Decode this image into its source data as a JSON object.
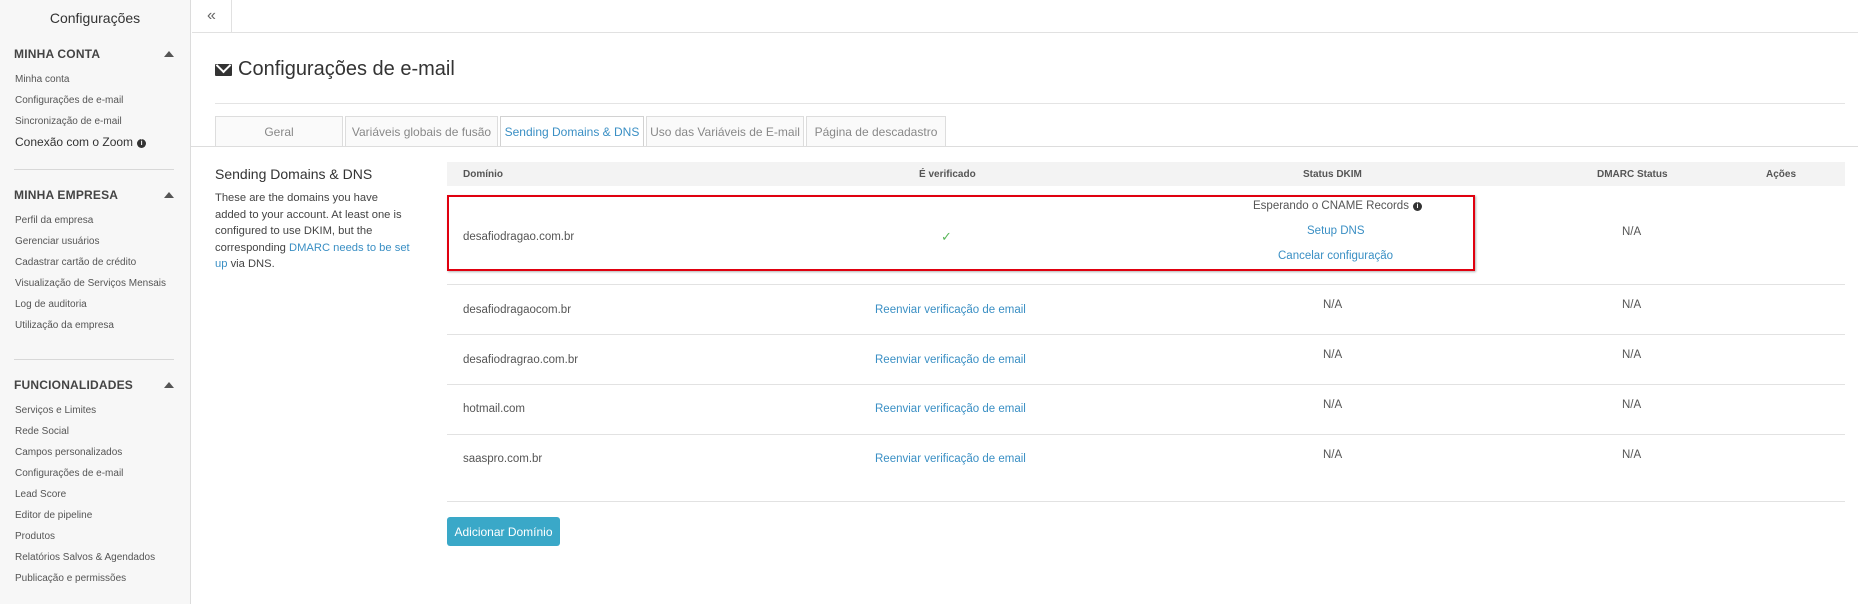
{
  "sidebar": {
    "title": "Configurações",
    "sections": [
      {
        "heading": "MINHA CONTA",
        "items": [
          "Minha conta",
          "Configurações de e-mail",
          "Sincronização de e-mail",
          "Conexão com o Zoom"
        ]
      },
      {
        "heading": "MINHA EMPRESA",
        "items": [
          "Perfil da empresa",
          "Gerenciar usuários",
          "Cadastrar cartão de crédito",
          "Visualização de Serviços Mensais",
          "Log de auditoria",
          "Utilização da empresa"
        ]
      },
      {
        "heading": "FUNCIONALIDADES",
        "items": [
          "Serviços e Limites",
          "Rede Social",
          "Campos personalizados",
          "Configurações de e-mail",
          "Lead Score",
          "Editor de pipeline",
          "Produtos",
          "Relatórios Salvos & Agendados",
          "Publicação e permissões"
        ]
      }
    ]
  },
  "topbar": {
    "collapse_glyph": "«"
  },
  "page": {
    "title": "Configurações de e-mail"
  },
  "tabs": [
    "Geral",
    "Variáveis globais de fusão",
    "Sending Domains & DNS",
    "Uso das Variáveis de E-mail",
    "Página de descadastro"
  ],
  "description": {
    "heading": "Sending Domains & DNS",
    "text_before": "These are the domains you have added to your account. At least one is configured to use DKIM, but the corresponding",
    "link": "DMARC needs to be set up",
    "text_after": "via DNS."
  },
  "table": {
    "headers": {
      "domain": "Domínio",
      "verified": "É verificado",
      "dkim": "Status DKIM",
      "dmarc": "DMARC Status",
      "actions": "Ações"
    },
    "rows": [
      {
        "domain": "desafiodragao.com.br",
        "verified": "✓",
        "dkim_status": "Esperando o CNAME Records",
        "dkim_link1": "Setup DNS",
        "dkim_link2": "Cancelar configuração",
        "dmarc": "N/A"
      },
      {
        "domain": "desafiodragaocom.br",
        "verified": "Reenviar verificação de email",
        "dkim_status": "N/A",
        "dmarc": "N/A"
      },
      {
        "domain": "desafiodragrao.com.br",
        "verified": "Reenviar verificação de email",
        "dkim_status": "N/A",
        "dmarc": "N/A"
      },
      {
        "domain": "hotmail.com",
        "verified": "Reenviar verificação de email",
        "dkim_status": "N/A",
        "dmarc": "N/A"
      },
      {
        "domain": "saaspro.com.br",
        "verified": "Reenviar verificação de email",
        "dkim_status": "N/A",
        "dmarc": "N/A"
      }
    ]
  },
  "add_button": "Adicionar Domínio",
  "colors": {
    "accent": "#3a8fc4",
    "button": "#3aa8c8",
    "highlight": "#e0000f",
    "check": "#5bb75b"
  }
}
